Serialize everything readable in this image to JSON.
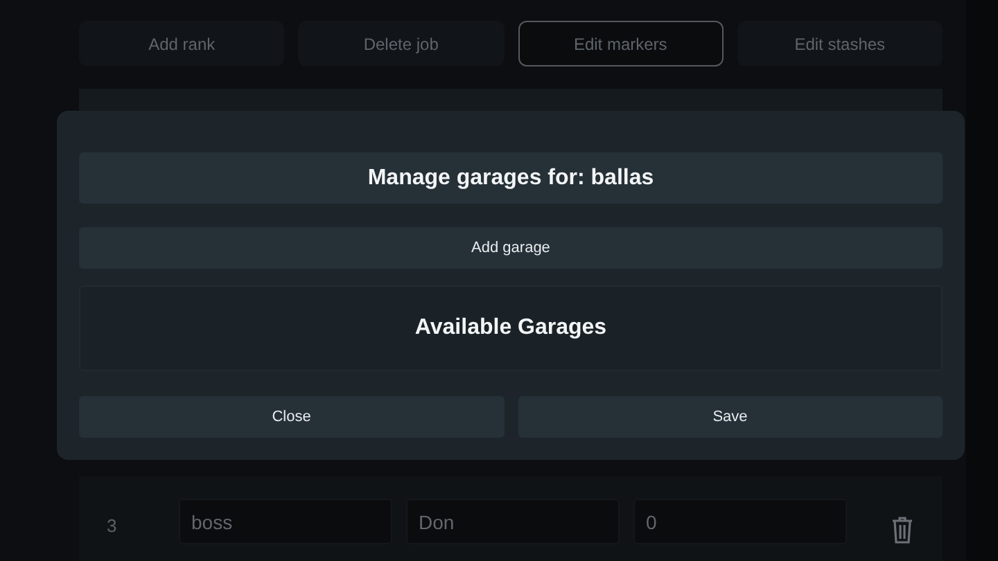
{
  "actions": [
    {
      "label": "Add rank",
      "selected": false
    },
    {
      "label": "Delete job",
      "selected": false
    },
    {
      "label": "Edit markers",
      "selected": true
    },
    {
      "label": "Edit stashes",
      "selected": false
    }
  ],
  "table": {
    "rows": [
      {
        "grade": "3",
        "name": "boss",
        "label": "Don",
        "salary": "0"
      }
    ]
  },
  "modal": {
    "title": "Manage garages for: ballas",
    "add_button": "Add garage",
    "section_title": "Available Garages",
    "buttons": [
      "Close",
      "Save"
    ]
  }
}
